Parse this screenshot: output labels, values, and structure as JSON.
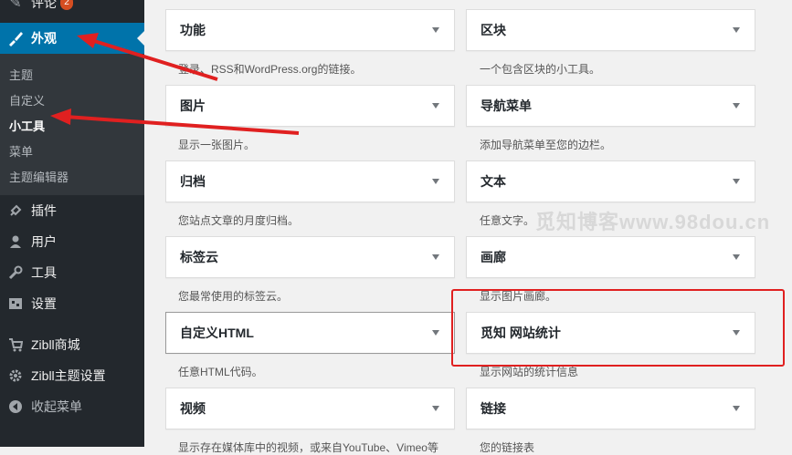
{
  "sidebar": {
    "top_label": "评论",
    "top_badge": "2",
    "active_label": "外观",
    "submenu": [
      "主题",
      "自定义",
      "小工具",
      "菜单",
      "主题编辑器"
    ],
    "items": [
      {
        "label": "插件",
        "icon": "plugin-icon"
      },
      {
        "label": "用户",
        "icon": "user-icon"
      },
      {
        "label": "工具",
        "icon": "wrench-icon"
      },
      {
        "label": "设置",
        "icon": "settings-icon"
      },
      {
        "label": "Zibll商城",
        "icon": "cart-icon"
      },
      {
        "label": "Zibll主题设置",
        "icon": "gear-icon"
      },
      {
        "label": "收起菜单",
        "icon": "collapse-icon"
      }
    ]
  },
  "widgets": [
    {
      "title": "功能",
      "desc": "登录、RSS和WordPress.org的链接。"
    },
    {
      "title": "区块",
      "desc": "一个包含区块的小工具。"
    },
    {
      "title": "图片",
      "desc": "显示一张图片。"
    },
    {
      "title": "导航菜单",
      "desc": "添加导航菜单至您的边栏。"
    },
    {
      "title": "归档",
      "desc": "您站点文章的月度归档。"
    },
    {
      "title": "文本",
      "desc": "任意文字。"
    },
    {
      "title": "标签云",
      "desc": "您最常使用的标签云。"
    },
    {
      "title": "画廊",
      "desc": "显示图片画廊。"
    },
    {
      "title": "自定义HTML",
      "desc": "任意HTML代码。"
    },
    {
      "title": "觅知 网站统计",
      "desc": "显示网站的统计信息"
    },
    {
      "title": "视频",
      "desc": "显示存在媒体库中的视频，或来自YouTube、Vimeo等"
    },
    {
      "title": "链接",
      "desc": "您的链接表"
    }
  ],
  "watermark": "觅知博客www.98dou.cn",
  "colors": {
    "accent": "#0073aa",
    "annotation": "#e02020",
    "sidebar": "#23282d"
  }
}
